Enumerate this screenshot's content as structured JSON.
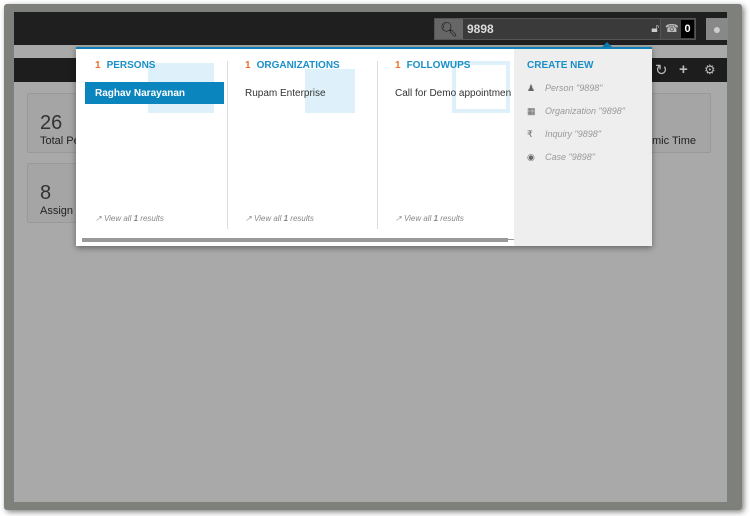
{
  "topbar": {
    "search_value": "9898",
    "call_count": "0"
  },
  "dashboard": {
    "cards": [
      {
        "value": "26",
        "label": "Total Pe"
      },
      {
        "value": "8",
        "label": "Assign T"
      }
    ],
    "right_card_label": "mic Time"
  },
  "dropdown": {
    "persons": {
      "count": "1",
      "label": "PERSONS",
      "items": [
        "Raghav Narayanan"
      ],
      "view_all": "View all",
      "view_count": "1",
      "view_suffix": "results"
    },
    "organizations": {
      "count": "1",
      "label": "ORGANIZATIONS",
      "items": [
        "Rupam Enterprise"
      ],
      "view_all": "View all",
      "view_count": "1",
      "view_suffix": "results"
    },
    "followups": {
      "count": "1",
      "label": "FOLLOWUPS",
      "items": [
        "Call for Demo appointmen"
      ],
      "view_all": "View all",
      "view_count": "1",
      "view_suffix": "results"
    },
    "create_new": {
      "title": "CREATE NEW",
      "items": [
        "Person \"9898\"",
        "Organization \"9898\"",
        "Inquiry \"9898\"",
        "Case \"9898\""
      ]
    }
  },
  "colors": {
    "accent": "#0b85be",
    "count": "#e8702a"
  }
}
